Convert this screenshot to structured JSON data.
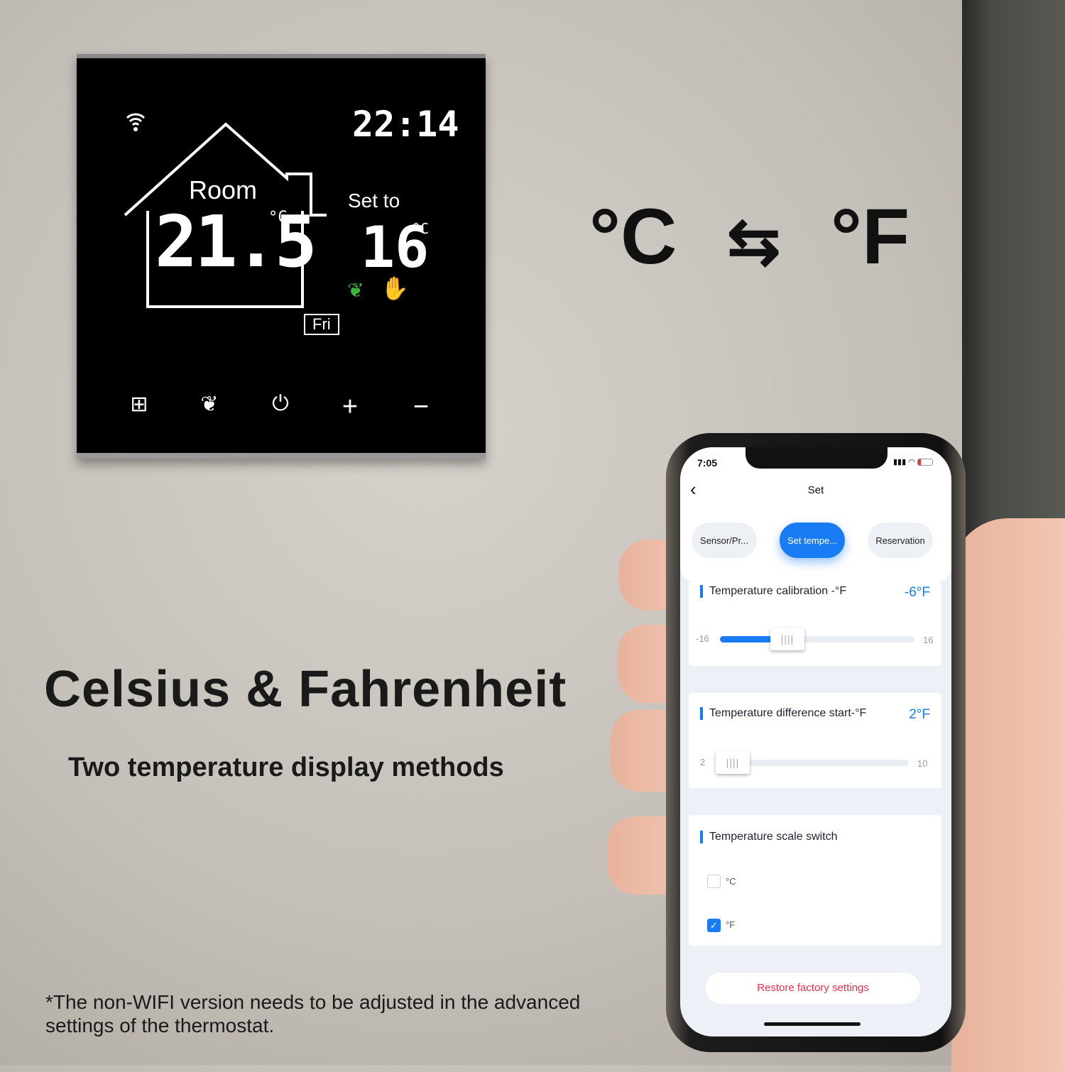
{
  "thermostat": {
    "room_label": "Room",
    "room_temp": "21.5",
    "room_unit": "°C",
    "clock": "22:14",
    "set_label": "Set to",
    "set_temp": "16",
    "set_unit": "°C",
    "day": "Fri",
    "buttons": [
      {
        "icon": "menu-grid-icon",
        "glyph": "⊞"
      },
      {
        "icon": "eco-leaf-icon",
        "glyph": "❦"
      },
      {
        "icon": "power-icon",
        "glyph": "⏻"
      },
      {
        "icon": "plus-icon",
        "glyph": "+"
      },
      {
        "icon": "minus-icon",
        "glyph": "−"
      }
    ],
    "status_icons": [
      "wifi-icon",
      "eco-leaf-icon",
      "manual-hand-icon"
    ],
    "eco_color": "#3db33d"
  },
  "conversion": {
    "celsius": "°C",
    "fahrenheit": "°F",
    "arrow": "⇆"
  },
  "headline": "Celsius & Fahrenheit",
  "subheadline": "Two temperature display methods",
  "footnote": "*The non-WIFI version needs to be adjusted in the advanced settings of the thermostat.",
  "phone": {
    "status": {
      "time": "7:05",
      "battery_level": "low"
    },
    "header": {
      "back": "‹",
      "title": "Set"
    },
    "tabs": [
      {
        "label": "Sensor/Pr...",
        "active": false
      },
      {
        "label": "Set tempe...",
        "active": true
      },
      {
        "label": "Reservation",
        "active": false
      }
    ],
    "calibration": {
      "title": "Temperature calibration -°F",
      "value": "-6°F",
      "min": "-16",
      "max": "16",
      "current": -6
    },
    "difference": {
      "title": "Temperature difference start-°F",
      "value": "2°F",
      "min": "2",
      "max": "10",
      "current": 2
    },
    "scale": {
      "title": "Temperature scale switch",
      "options": [
        {
          "label": "°C",
          "checked": false
        },
        {
          "label": "°F",
          "checked": true
        }
      ]
    },
    "restore_label": "Restore factory settings",
    "accent": "#1a7cf5",
    "danger": "#f0304a"
  }
}
